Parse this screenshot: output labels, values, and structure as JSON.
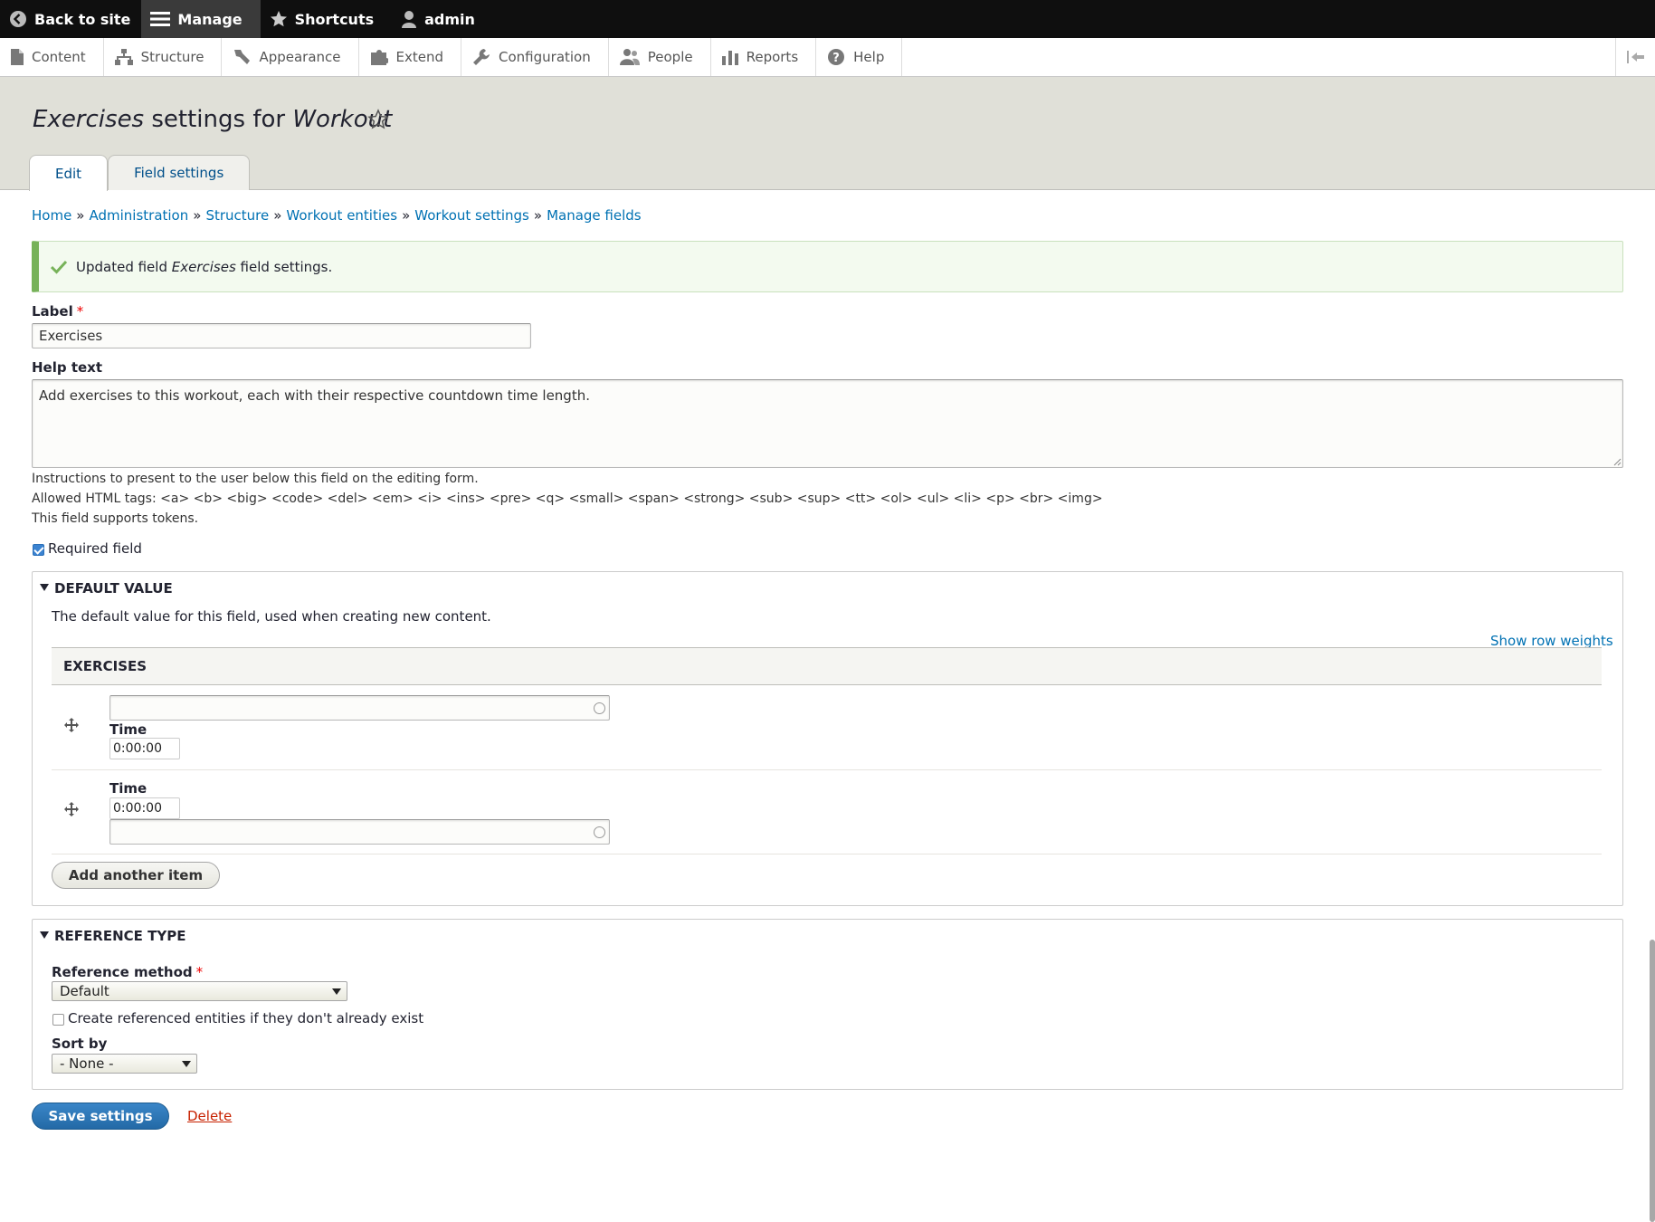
{
  "toolbar": {
    "back_to_site": "Back to site",
    "manage": "Manage",
    "shortcuts": "Shortcuts",
    "user": "admin"
  },
  "tray": {
    "content": "Content",
    "structure": "Structure",
    "appearance": "Appearance",
    "extend": "Extend",
    "configuration": "Configuration",
    "people": "People",
    "reports": "Reports",
    "help": "Help"
  },
  "header": {
    "title_em1": "Exercises",
    "title_mid": " settings for ",
    "title_em2": "Workout",
    "tabs": [
      {
        "label": "Edit",
        "active": true
      },
      {
        "label": "Field settings",
        "active": false
      }
    ]
  },
  "breadcrumb": [
    "Home",
    "Administration",
    "Structure",
    "Workout entities",
    "Workout settings",
    "Manage fields"
  ],
  "breadcrumb_sep": "»",
  "status": {
    "prefix": "Updated field ",
    "field": "Exercises",
    "suffix": " field settings."
  },
  "form": {
    "label_title": "Label",
    "label_value": "Exercises",
    "help_title": "Help text",
    "help_value": "Add exercises to this workout, each with their respective countdown time length.",
    "help_desc1": "Instructions to present to the user below this field on the editing form.",
    "help_desc2": "Allowed HTML tags: <a> <b> <big> <code> <del> <em> <i> <ins> <pre> <q> <small> <span> <strong> <sub> <sup> <tt> <ol> <ul> <li> <p> <br> <img>",
    "help_desc3": "This field supports tokens.",
    "required_label": "Required field",
    "required_checked": true
  },
  "default_value": {
    "summary": "Default value",
    "description": "The default value for this field, used when creating new content.",
    "show_row_weights": "Show row weights",
    "table_header": "Exercises",
    "rows": [
      {
        "time_label": "Time",
        "time_value": "0:00:00"
      },
      {
        "time_label": "Time",
        "time_value": "0:00:00"
      }
    ],
    "add_another": "Add another item"
  },
  "reference_type": {
    "summary": "Reference type",
    "method_label": "Reference method",
    "method_value": "Default",
    "create_label": "Create referenced entities if they don't already exist",
    "create_checked": false,
    "sort_label": "Sort by",
    "sort_value": "- None -"
  },
  "actions": {
    "save": "Save settings",
    "delete": "Delete"
  },
  "colors": {
    "toolbar_bg": "#0f0f0f",
    "link": "#0071b3",
    "primary_button": "#2a74b7",
    "status_green": "#77b259",
    "danger_link": "#c72100"
  }
}
